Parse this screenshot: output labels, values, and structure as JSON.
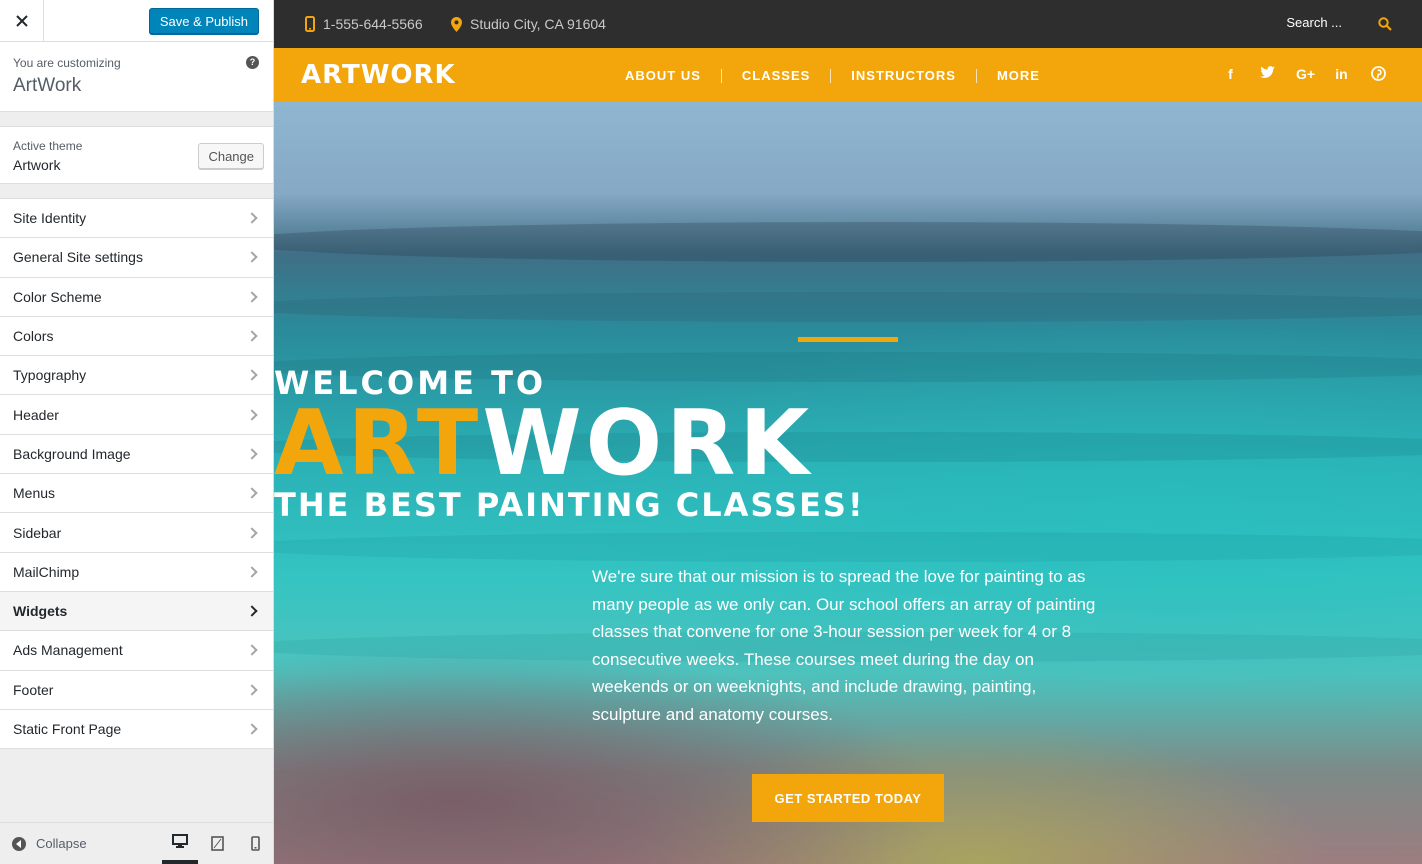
{
  "customizer": {
    "publish_label": "Save & Publish",
    "customizing_label": "You are customizing",
    "site_name": "ArtWork",
    "active_theme_label": "Active theme",
    "active_theme_name": "Artwork",
    "change_label": "Change",
    "sections": [
      {
        "label": "Site Identity"
      },
      {
        "label": "General Site settings"
      },
      {
        "label": "Color Scheme"
      },
      {
        "label": "Colors"
      },
      {
        "label": "Typography"
      },
      {
        "label": "Header"
      },
      {
        "label": "Background Image"
      },
      {
        "label": "Menus"
      },
      {
        "label": "Sidebar"
      },
      {
        "label": "MailChimp"
      },
      {
        "label": "Widgets"
      },
      {
        "label": "Ads Management"
      },
      {
        "label": "Footer"
      },
      {
        "label": "Static Front Page"
      }
    ],
    "active_section": "Widgets",
    "collapse_label": "Collapse",
    "active_device": "desktop"
  },
  "site": {
    "phone": "1-555-644-5566",
    "location": "Studio City, CA 91604",
    "search_placeholder": "Search ...",
    "logo": "ARTWORK",
    "menu": [
      "ABOUT US",
      "CLASSES",
      "INSTRUCTORS",
      "MORE"
    ],
    "social": [
      "f",
      "t",
      "G+",
      "in",
      "p"
    ],
    "hero": {
      "welcome": "WELCOME TO",
      "title_accent": "ART",
      "title_rest": "WORK",
      "subtitle": "THE BEST PAINTING CLASSES!",
      "description": "We're sure that our mission is to spread the love for painting to as many people as we only can. Our school offers an array of painting classes that convene for one 3-hour session per week for 4 or 8 consecutive weeks. These courses meet during the day on weekends or on weeknights, and include drawing, painting, sculpture and anatomy courses.",
      "cta": "GET STARTED TODAY"
    }
  },
  "colors": {
    "accent": "#f3a50c",
    "topbar": "#2f2e2e",
    "publish_blue": "#0085ba"
  }
}
